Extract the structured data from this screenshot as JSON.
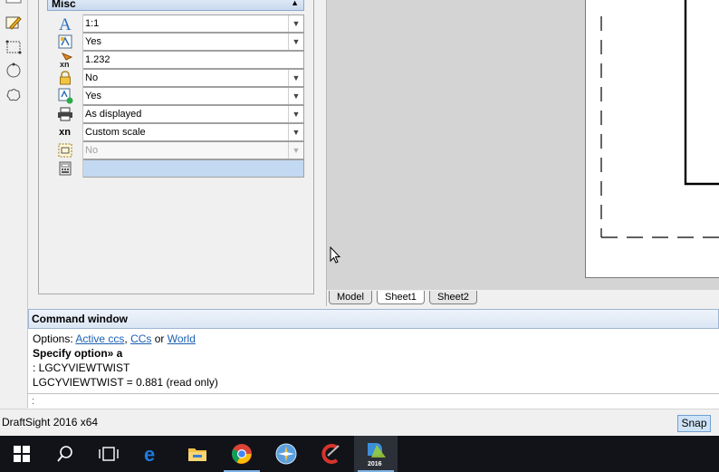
{
  "toolstrip": {
    "tools": [
      "pencil-edit-icon",
      "rectangle-tool-icon",
      "circle-tool-icon",
      "cloud-shape-icon"
    ]
  },
  "properties": {
    "section_title": "Misc",
    "rows": [
      {
        "icon": "annotation-text-icon",
        "value": "1:1",
        "dropdown": true,
        "state": "normal"
      },
      {
        "icon": "viewport-toggle-icon",
        "value": "Yes",
        "dropdown": true,
        "state": "normal"
      },
      {
        "icon": "scale-factor-icon",
        "value": "1.232",
        "dropdown": false,
        "state": "normal"
      },
      {
        "icon": "lock-icon",
        "value": "No",
        "dropdown": true,
        "state": "normal"
      },
      {
        "icon": "viewport-on-icon",
        "value": "Yes",
        "dropdown": true,
        "state": "normal"
      },
      {
        "icon": "print-icon",
        "value": "As displayed",
        "dropdown": true,
        "state": "normal"
      },
      {
        "icon": "xn-scale-icon",
        "value": "Custom scale",
        "dropdown": true,
        "state": "normal"
      },
      {
        "icon": "dashed-viewport-icon",
        "value": "No",
        "dropdown": true,
        "state": "disabled"
      },
      {
        "icon": "calculator-icon",
        "value": "",
        "dropdown": false,
        "state": "selected"
      }
    ],
    "xn_label": "xn"
  },
  "sheet_tabs": [
    "Model",
    "Sheet1",
    "Sheet2"
  ],
  "active_tab": "Sheet1",
  "command_window": {
    "title": "Command window",
    "options_prefix": "Options: ",
    "option_active_ccs": "Active ccs",
    "option_sep1": ", ",
    "option_ccs": "CCs",
    "option_or": " or ",
    "option_world": "World",
    "prompt": "Specify option» a",
    "line3": ": LGCYVIEWTWIST",
    "line4": "LGCYVIEWTWIST = 0.881 (read only)",
    "input_prompt": ":"
  },
  "status_bar": {
    "app_name": "DraftSight 2016 x64",
    "snap_label": "Snap"
  },
  "taskbar": {
    "items": [
      "windows-start-icon",
      "search-icon",
      "task-view-icon",
      "edge-icon",
      "file-explorer-icon",
      "chrome-icon",
      "app-compass-icon",
      "ccleaner-icon",
      "draftsight-icon"
    ],
    "draftsight_badge": "2016"
  },
  "colors": {
    "accent": "#1b5fb4",
    "header_blue": "#c9d9ef",
    "taskbar": "#111318"
  }
}
